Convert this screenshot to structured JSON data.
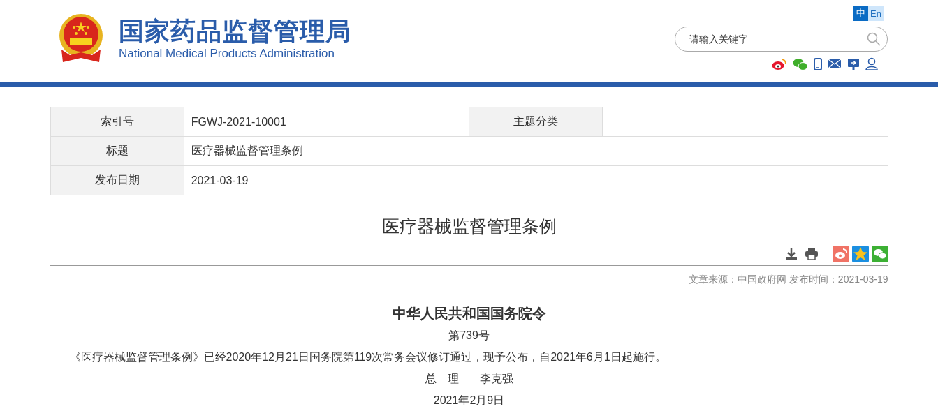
{
  "header": {
    "title": "国家药品监督管理局",
    "subtitle": "National Medical Products Administration",
    "languages": [
      {
        "label": "中",
        "selected": true
      },
      {
        "label": "En",
        "selected": false
      }
    ],
    "search": {
      "placeholder": "请输入关键字"
    },
    "share_icons": [
      {
        "kind": "weibo"
      },
      {
        "kind": "wechat"
      },
      {
        "kind": "phone"
      },
      {
        "kind": "mail"
      },
      {
        "kind": "screen"
      },
      {
        "kind": "user"
      }
    ]
  },
  "info_table": {
    "rows": [
      [
        {
          "label": "索引号",
          "value": "FGWJ-2021-10001"
        },
        {
          "label": "主题分类"
        }
      ],
      [
        {
          "label": "标题",
          "value": "医疗器械监督管理条例"
        }
      ],
      [
        {
          "label": "发布日期",
          "value": "2021-03-19"
        }
      ]
    ]
  },
  "article": {
    "title": "医疗器械监督管理条例",
    "tools": [
      {
        "kind": "download"
      },
      {
        "kind": "print"
      },
      {
        "kind": "weibo"
      },
      {
        "kind": "qzone"
      },
      {
        "kind": "wechat"
      }
    ],
    "source": "文章来源：中国政府网 发布时间：2021-03-19",
    "heading": "中华人民共和国国务院令",
    "number": "第739号",
    "paragraph": "《医疗器械监督管理条例》已经2020年12月21日国务院第119次常务会议修订通过，现予公布，自2021年6月1日起施行。",
    "signature": {
      "role": "总　理",
      "name": "李克强"
    },
    "date": "2021年2月9日"
  }
}
